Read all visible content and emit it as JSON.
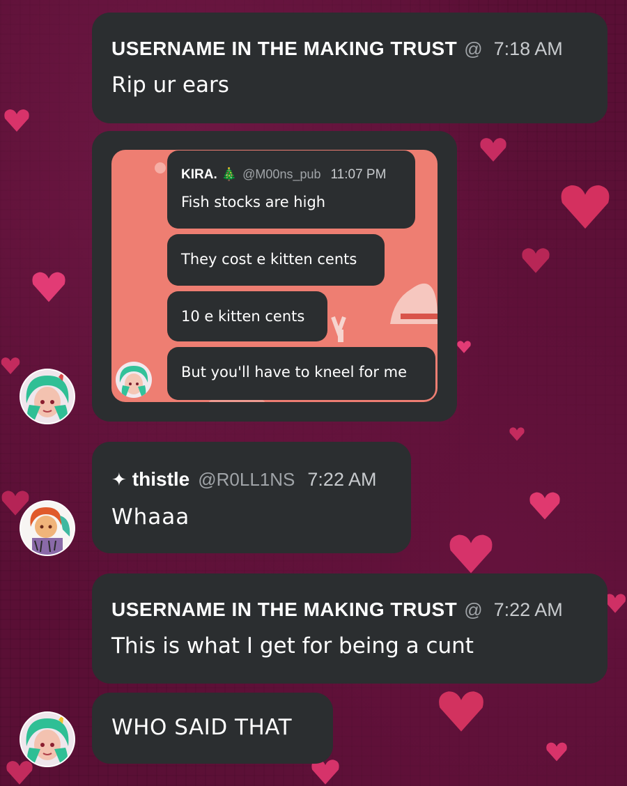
{
  "messages": [
    {
      "author": "USERNAME IN THE MAKING TRUST",
      "handle": "@",
      "time": "7:18 AM",
      "text": "Rip ur ears"
    },
    {
      "type": "image",
      "embed": {
        "author": "KIRA.",
        "badge": "🎄",
        "handle": "@M00ns_pub",
        "time": "11:07 PM",
        "lines": [
          "Fish stocks are high",
          "They cost e kitten cents",
          "10 e kitten cents",
          "But you'll have to kneel for me"
        ]
      }
    },
    {
      "author_icon": "✦",
      "author": "thistle",
      "handle": "@R0LL1NS",
      "time": "7:22 AM",
      "text": "Whaaa"
    },
    {
      "author": "USERNAME IN THE MAKING TRUST",
      "handle": "@",
      "time": "7:22 AM",
      "text": "This is what I get for being a cunt"
    },
    {
      "text": "WHO SAID THAT"
    }
  ],
  "colors": {
    "background": "#5a0f35",
    "bubble": "#2b2e30",
    "embed_bg": "#ee7e72",
    "heart": "#e0386e"
  },
  "icons": {
    "sparkle": "sparkle-icon",
    "tree": "christmas-tree-icon"
  }
}
